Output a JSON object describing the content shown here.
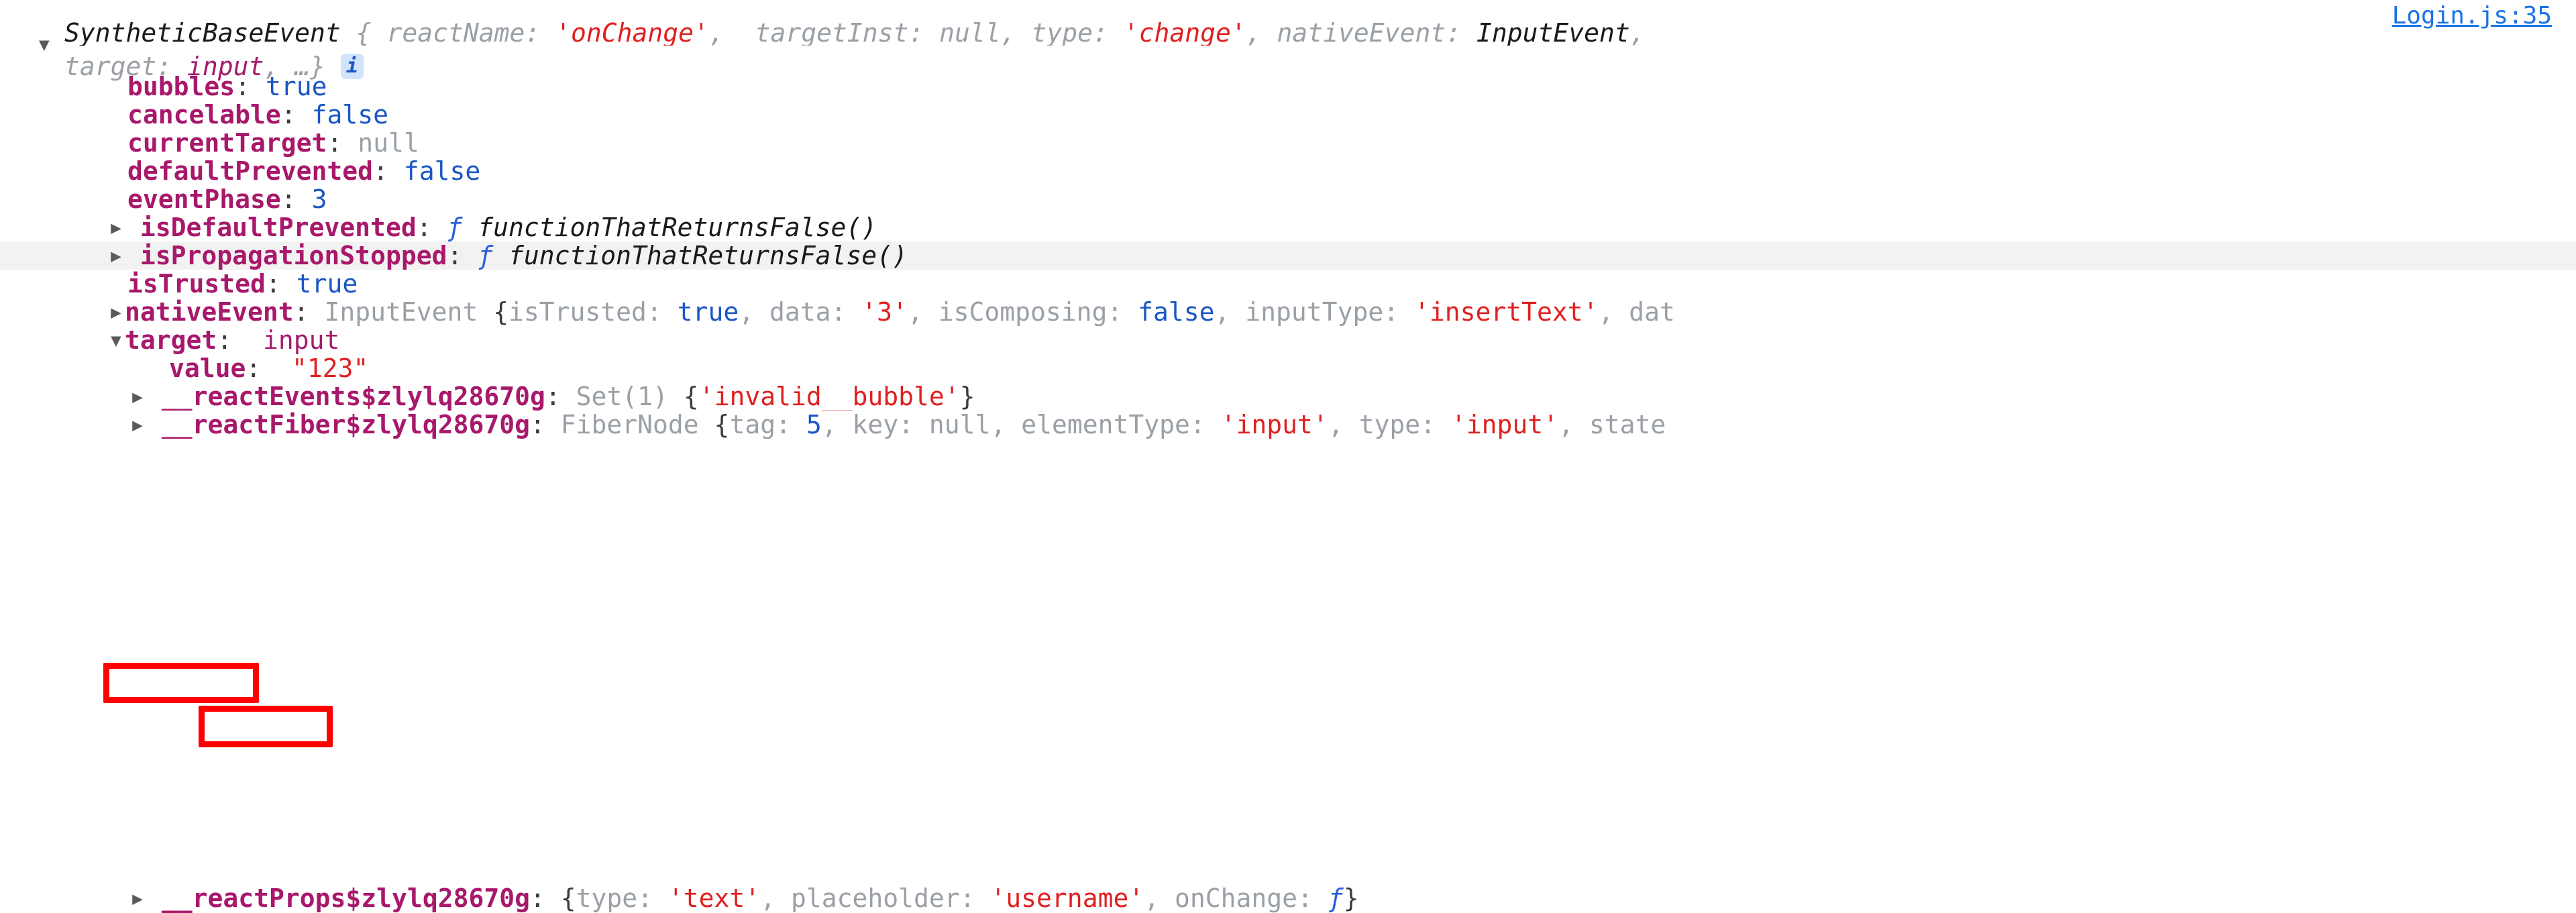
{
  "console": {
    "source_link": "Login.js:35",
    "info_badge": "i",
    "triangle_open": "▼",
    "triangle_closed": "▶",
    "colors": {
      "string": "#e02020",
      "property": "#a8186b",
      "boolean": "#1a56c4",
      "null": "#9aa0a6",
      "link": "#1a73e8",
      "annotation": "#ff0000",
      "highlight_row": "#f2f2f2",
      "background": "#ffffff"
    },
    "header": {
      "class_name": "SyntheticBaseEvent",
      "open_brace": "{",
      "p1_name": "_reactName:",
      "p1_value": "'onChange'",
      "sep1": ",",
      "p2_name": "_targetInst:",
      "p2_value": "null",
      "sep2": ",",
      "p3_name": "type:",
      "p3_value": "'change'",
      "sep3": ",",
      "p4_name": "nativeEvent:",
      "p4_value": "InputEvent",
      "sep4": ",",
      "p5_name": "target:",
      "p5_value": "input",
      "sep5": ",",
      "ellipsis": "…}"
    },
    "properties": [
      {
        "name": "bubbles",
        "colon": ":",
        "value": "true",
        "value_kind": "bool",
        "expandable": false,
        "highlighted": false
      },
      {
        "name": "cancelable",
        "colon": ":",
        "value": "false",
        "value_kind": "bool",
        "expandable": false,
        "highlighted": false
      },
      {
        "name": "currentTarget",
        "colon": ":",
        "value": "null",
        "value_kind": "null",
        "expandable": false,
        "highlighted": false
      },
      {
        "name": "defaultPrevented",
        "colon": ":",
        "value": "false",
        "value_kind": "bool",
        "expandable": false,
        "highlighted": false
      },
      {
        "name": "eventPhase",
        "colon": ":",
        "value": "3",
        "value_kind": "num",
        "expandable": false,
        "highlighted": false
      },
      {
        "name": "isDefaultPrevented",
        "colon": ":",
        "fn_mark": "ƒ",
        "value": "functionThatReturnsFalse()",
        "value_kind": "function",
        "expandable": true,
        "highlighted": false
      },
      {
        "name": "isPropagationStopped",
        "colon": ":",
        "fn_mark": "ƒ",
        "value": "functionThatReturnsFalse()",
        "value_kind": "function",
        "expandable": true,
        "highlighted": true
      },
      {
        "name": "isTrusted",
        "colon": ":",
        "value": "true",
        "value_kind": "bool",
        "expandable": false,
        "highlighted": false
      }
    ],
    "native_event_row": {
      "name": "nativeEvent",
      "colon": ":",
      "ctor": "InputEvent",
      "open_brace": "{",
      "k1": "isTrusted:",
      "v1": "true",
      "s1": ",",
      "k2": "data:",
      "v2": "'3'",
      "s2": ",",
      "k3": "isComposing:",
      "v3": "false",
      "s3": ",",
      "k4": "inputType:",
      "v4": "'insertText'",
      "s4": ",",
      "k5_truncated": "dat"
    },
    "target_row": {
      "name": "target",
      "colon": ":",
      "value": "input"
    },
    "value_row": {
      "name": "value",
      "colon": ":",
      "value": "\"123\""
    },
    "react_events_row": {
      "name": "__reactEvents$zlylq28670g",
      "colon": ":",
      "ctor": "Set(1)",
      "open_brace": "{",
      "entry": "'invalid__bubble'",
      "close_brace": "}"
    },
    "react_fiber_row": {
      "name": "__reactFiber$zlylq28670g",
      "colon": ":",
      "ctor": "FiberNode",
      "open_brace": "{",
      "k1": "tag:",
      "v1": "5",
      "s1": ",",
      "k2": "key:",
      "v2": "null",
      "s2": ",",
      "k3": "elementType:",
      "v3": "'input'",
      "s3": ",",
      "k4": "type:",
      "v4": "'input'",
      "s4": ",",
      "k5_truncated": "state"
    },
    "react_props_row": {
      "name": "__reactProps$zlylq28670g",
      "colon": ":",
      "open_brace": "{",
      "k1": "type:",
      "v1": "'text'",
      "s1": ",",
      "k2": "placeholder:",
      "v2": "'username'",
      "s2": ",",
      "k3": "onChange:",
      "v3": "ƒ",
      "close_brace": "}"
    },
    "annotations": [
      {
        "id": "annot-target",
        "label": "target-key-highlight"
      },
      {
        "id": "annot-value",
        "label": "value-key-highlight"
      }
    ]
  }
}
